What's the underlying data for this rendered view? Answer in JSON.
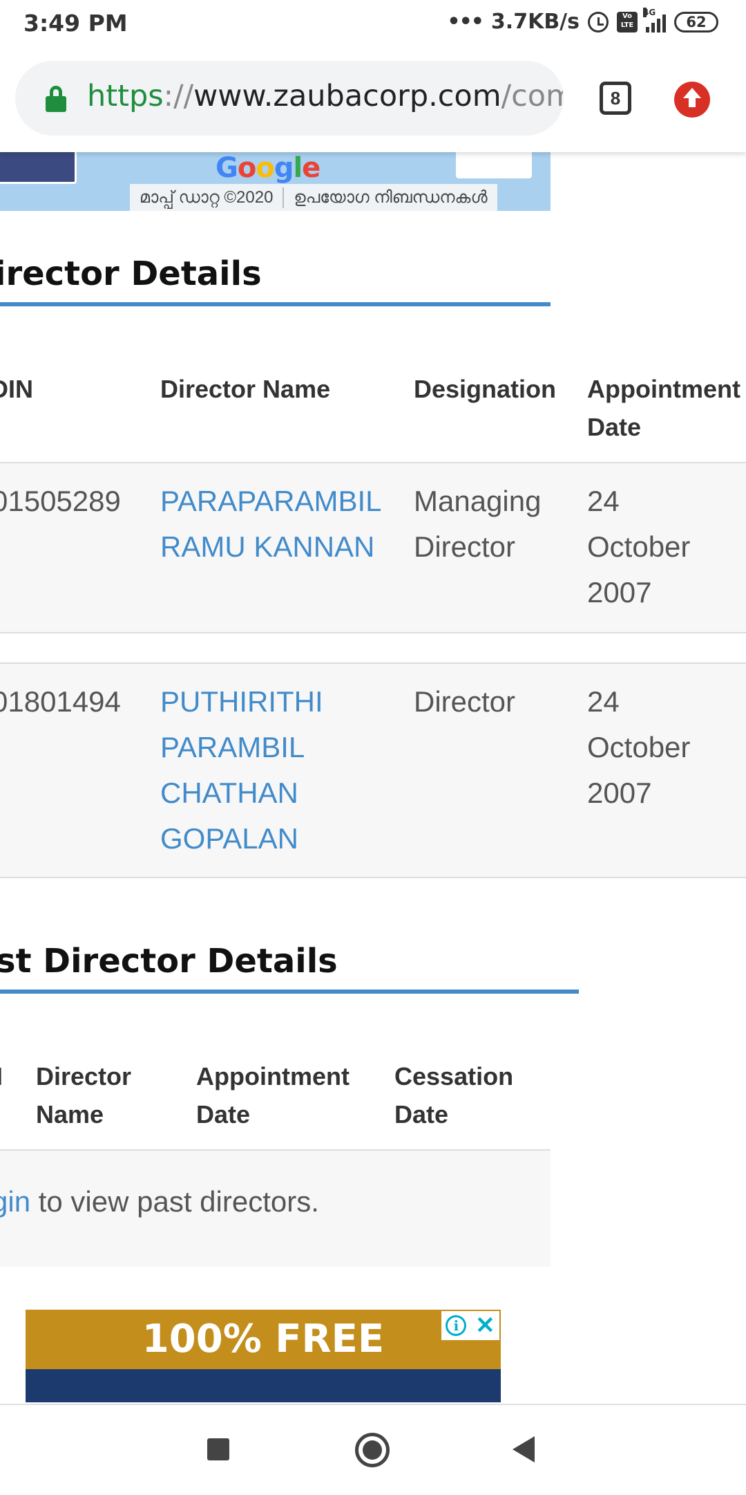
{
  "status_bar": {
    "time": "3:49 PM",
    "net_speed": "3.7KB/s",
    "dots": "•••",
    "network_label": "4G",
    "volte_label": "Vo LTE",
    "battery": "62"
  },
  "browser": {
    "url_scheme": "https",
    "url_sep": "://",
    "url_host": "www.zaubacorp.com",
    "url_path": "/com",
    "tab_count": "8"
  },
  "map": {
    "logo": "Google",
    "attribution": "മാപ്പ് ഡാറ്റ ©2020",
    "terms": "ഉപയോഗ നിബന്ധനകൾ"
  },
  "directors": {
    "title": "irector Details",
    "headers": {
      "din": "DIN",
      "name": "Director Name",
      "designation": "Designation",
      "appointment_line1": "Appointment",
      "appointment_line2": "Date"
    },
    "rows": [
      {
        "din": "01505289",
        "name_line1": "PARAPARAMBIL",
        "name_line2": "RAMU KANNAN",
        "designation_line1": "Managing",
        "designation_line2": "Director",
        "date_line1": "24",
        "date_line2": "October",
        "date_line3": "2007"
      },
      {
        "din": "01801494",
        "name_line1": "PUTHIRITHI",
        "name_line2": "PARAMBIL",
        "name_line3": "CHATHAN",
        "name_line4": "GOPALAN",
        "designation_line1": "Director",
        "date_line1": "24",
        "date_line2": "October",
        "date_line3": "2007"
      }
    ]
  },
  "past_directors": {
    "title": "st Director Details",
    "headers": {
      "din": "I",
      "name_line1": "Director",
      "name_line2": "Name",
      "appointment_line1": "Appointment",
      "appointment_line2": "Date",
      "cessation_line1": "Cessation",
      "cessation_line2": "Date"
    },
    "login_link": "gin",
    "login_suffix": " to view past directors."
  },
  "ad": {
    "headline": "100% FREE",
    "info_glyph": "i",
    "close_glyph": "✕"
  }
}
